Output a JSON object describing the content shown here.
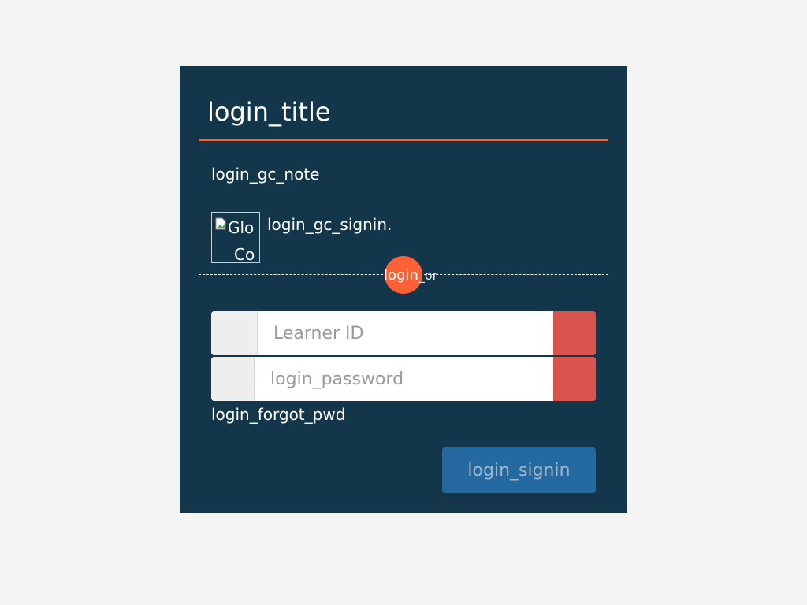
{
  "login": {
    "title": "login_title",
    "gc_note": "login_gc_note",
    "gc_image_alt_line1": "Glo",
    "gc_image_alt_line2": "Co",
    "gc_signin": "login_gc_signin.",
    "or_label": "login",
    "or_suffix": "_or",
    "learner_id_placeholder": "Learner ID",
    "password_placeholder": "login_password",
    "forgot_pwd": "login_forgot_pwd",
    "signin_button": "login_signin"
  },
  "colors": {
    "panel_bg": "#13364b",
    "accent": "#ff6136",
    "error_addon": "#d9534f",
    "button_bg": "#2469a0",
    "page_bg": "#f4f4f4"
  },
  "icons": {
    "gc_image": "broken-image-icon"
  }
}
